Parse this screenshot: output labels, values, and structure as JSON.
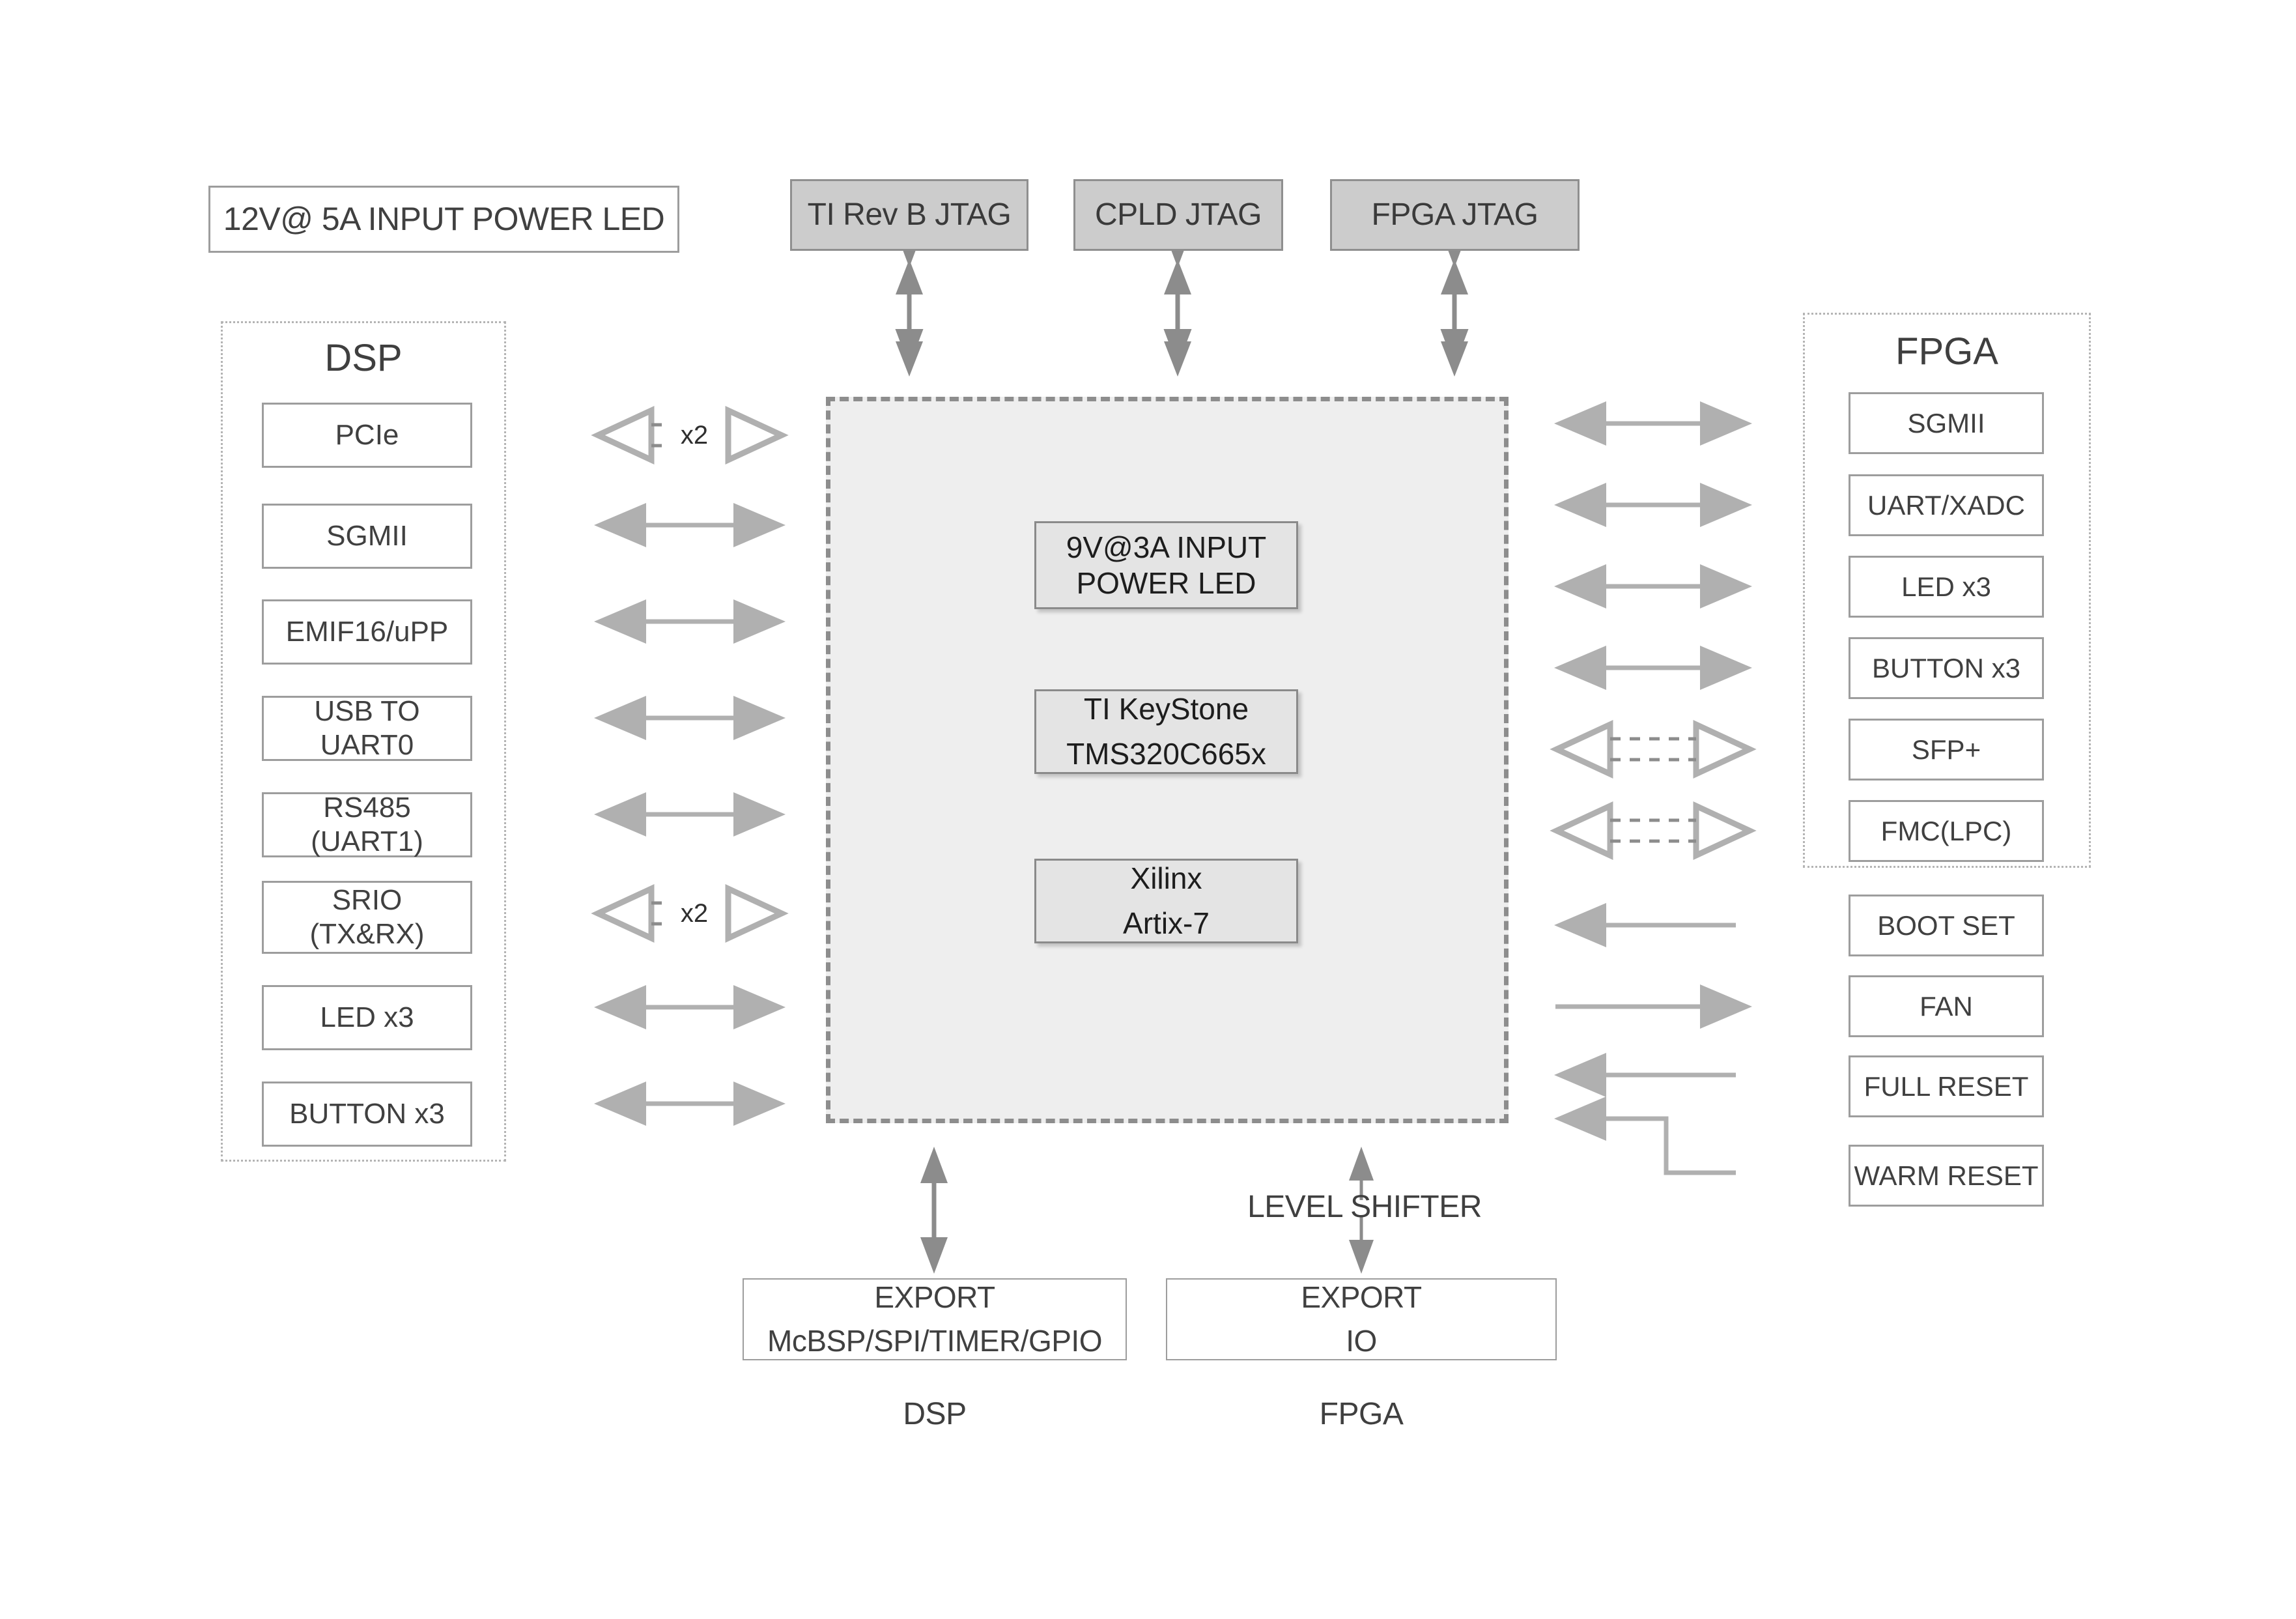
{
  "diagram": {
    "title_hidden": "",
    "colors": {
      "line": "#a6a6a6",
      "box_border": "#9d9d9d",
      "jtag_fill": "#cccccc",
      "core_fill": "#eeeeee",
      "chip_fill": "#e4e4e4",
      "text": "#404040"
    }
  },
  "power_led": {
    "label": "12V@ 5A INPUT POWER LED"
  },
  "jtag": {
    "items": [
      {
        "label": "TI Rev B JTAG"
      },
      {
        "label": "CPLD JTAG"
      },
      {
        "label": "FPGA JTAG"
      }
    ]
  },
  "dsp_group": {
    "title": "DSP",
    "items": [
      {
        "label": "PCIe"
      },
      {
        "label": "SGMII"
      },
      {
        "label": "EMIF16/uPP"
      },
      {
        "label": "USB TO UART0"
      },
      {
        "label": "RS485 (UART1)"
      },
      {
        "label": "SRIO\n(TX&RX)"
      },
      {
        "label": "LED x3"
      },
      {
        "label": "BUTTON x3"
      }
    ]
  },
  "fpga_group": {
    "title": "FPGA",
    "items": [
      {
        "label": "SGMII"
      },
      {
        "label": "UART/XADC"
      },
      {
        "label": "LED x3"
      },
      {
        "label": "BUTTON x3"
      },
      {
        "label": "SFP+"
      },
      {
        "label": "FMC(LPC)"
      }
    ]
  },
  "right_extra": {
    "items": [
      {
        "label": "BOOT SET"
      },
      {
        "label": "FAN"
      },
      {
        "label": "FULL RESET"
      },
      {
        "label": "WARM RESET"
      }
    ]
  },
  "core": {
    "chips": [
      {
        "label": "9V@3A INPUT\nPOWER LED"
      },
      {
        "label": "TI KeyStone\nTMS320C665x"
      },
      {
        "label": "Xilinx\nArtix-7"
      }
    ]
  },
  "exports": {
    "dsp_box": {
      "label": "EXPORT\nMcBSP/SPI/TIMER/GPIO"
    },
    "fpga_box": {
      "label": "EXPORT\nIO"
    },
    "dsp_caption": "DSP",
    "fpga_caption": "FPGA",
    "level_shifter": "LEVEL SHIFTER"
  },
  "left_links": {
    "multiplier_1": "x2",
    "multiplier_2": "x2"
  }
}
